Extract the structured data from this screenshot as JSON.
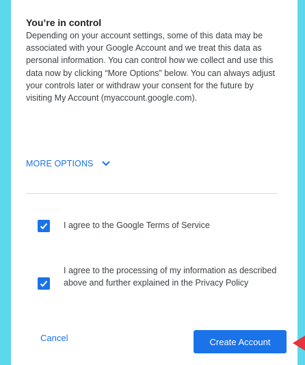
{
  "consent": {
    "title": "You’re in control",
    "body": "Depending on your account settings, some of this data may be associated with your Google Account and we treat this data as personal information. You can control how we collect and use this data now by clicking “More Options” below. You can always adjust your controls later or withdraw your consent for the future by visiting My Account (myaccount.google.com).",
    "more_options_label": "MORE OPTIONS",
    "more_options_icon": "chevron-down-icon"
  },
  "agreements": [
    {
      "label": "I agree to the Google Terms of Service",
      "checked": true,
      "icon": "checkmark-icon"
    },
    {
      "label": "I agree to the processing of my information as described above and further explained in the Privacy Policy",
      "checked": true,
      "icon": "checkmark-icon"
    }
  ],
  "actions": {
    "cancel_label": "Cancel",
    "create_label": "Create Account"
  },
  "colors": {
    "background": "#5bd8ec",
    "accent": "#1a73e8",
    "annotation_arrow": "#e8323c"
  }
}
